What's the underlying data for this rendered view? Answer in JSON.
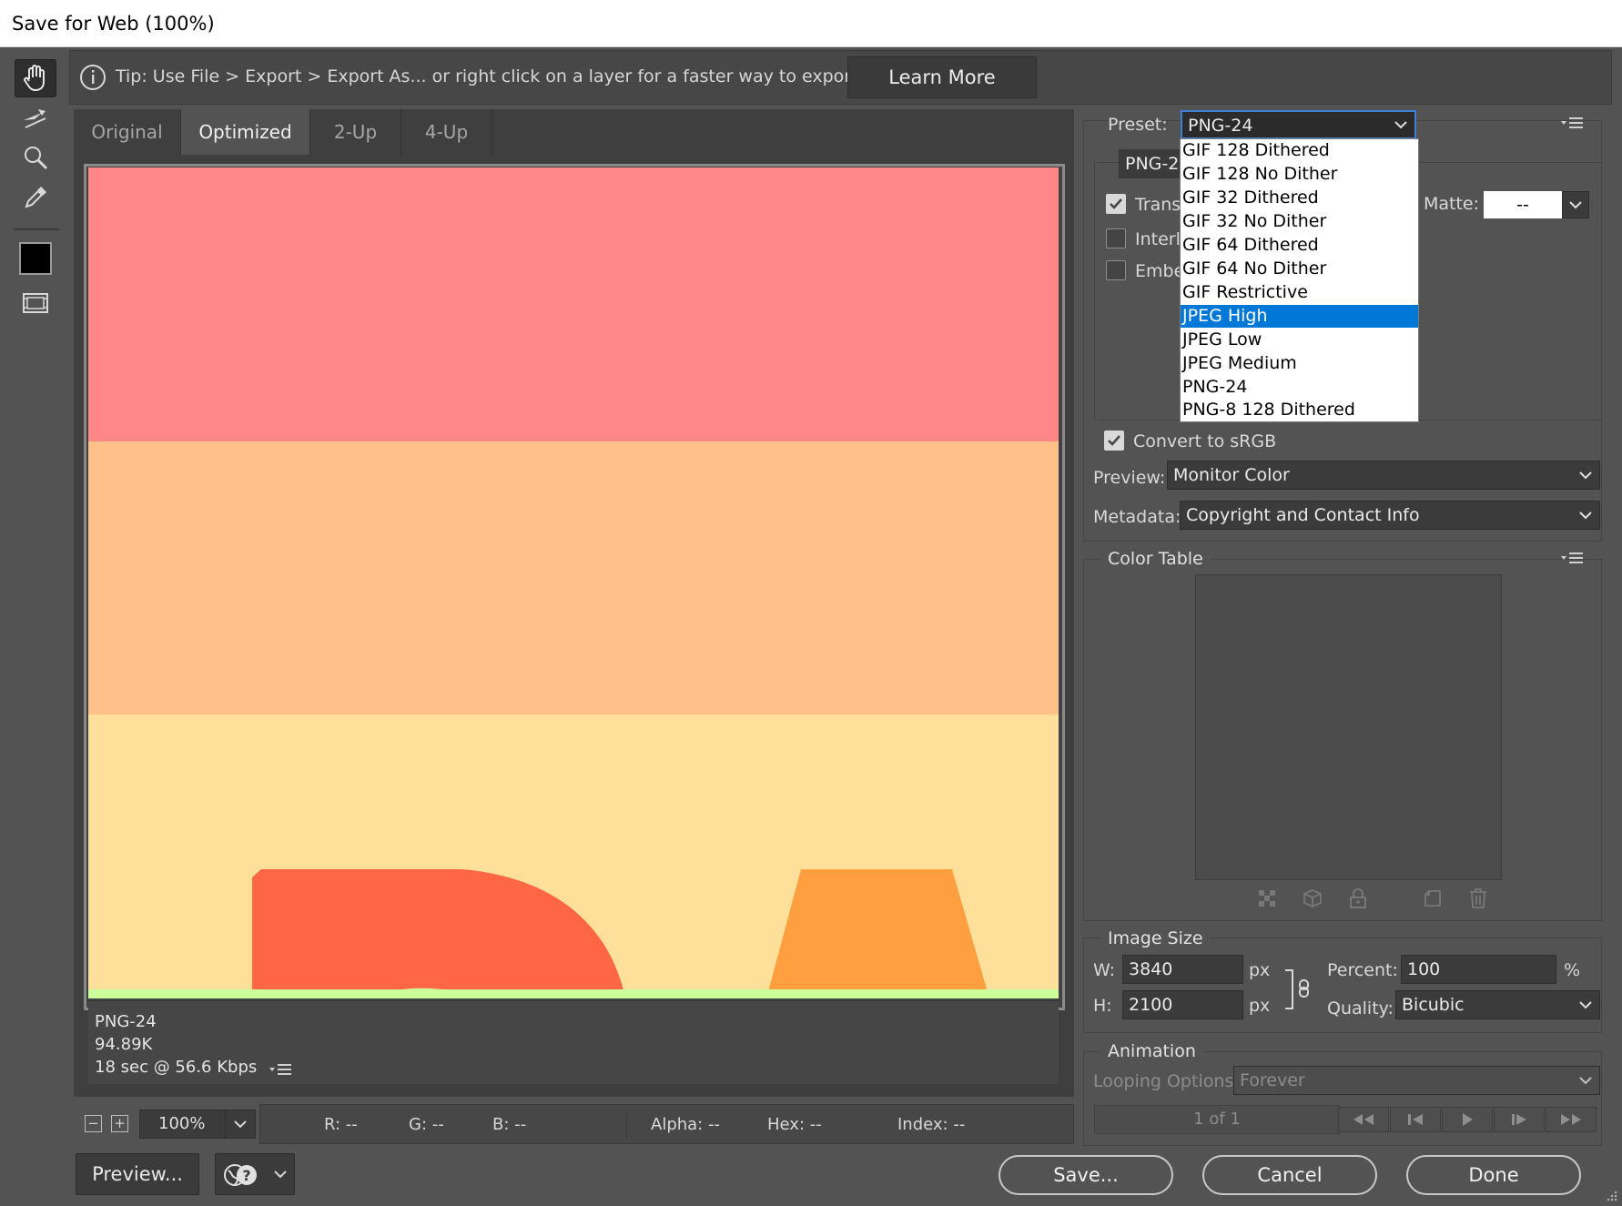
{
  "window": {
    "title": "Save for Web (100%)"
  },
  "tools": [
    {
      "name": "hand-icon",
      "active": true
    },
    {
      "name": "slice-select-icon"
    },
    {
      "name": "zoom-icon"
    },
    {
      "name": "eyedropper-icon"
    },
    {
      "name": "eyedropper-color-swatch",
      "color": "#000000"
    },
    {
      "name": "toggle-slices-icon"
    }
  ],
  "tip": {
    "text": "Tip: Use File > Export > Export As...  or right click on a layer for a faster way to export assets",
    "button": "Learn More"
  },
  "tabs": [
    "Original",
    "Optimized",
    "2-Up",
    "4-Up"
  ],
  "active_tab": "Optimized",
  "preview_info": {
    "format": "PNG-24",
    "size": "94.89K",
    "download": "18 sec @ 56.6 Kbps"
  },
  "status": {
    "zoom": "100%",
    "r": "R: --",
    "g": "G: --",
    "b": "B: --",
    "alpha": "Alpha: --",
    "hex": "Hex: --",
    "index": "Index: --"
  },
  "buttons": {
    "preview": "Preview...",
    "save": "Save...",
    "cancel": "Cancel",
    "done": "Done"
  },
  "settings": {
    "preset_label": "Preset:",
    "preset_value": "PNG-24",
    "format_value": "PNG-24",
    "transparency_label": "Trans",
    "interlaced_label": "Interl",
    "embed_label": "Embe",
    "matte_label": "Matte:",
    "matte_value": "--",
    "convert_srgb": "Convert to sRGB",
    "preview_label": "Preview:",
    "preview_value": "Monitor Color",
    "metadata_label": "Metadata:",
    "metadata_value": "Copyright and Contact Info"
  },
  "preset_options": [
    "GIF 128 Dithered",
    "GIF 128 No Dither",
    "GIF 32 Dithered",
    "GIF 32 No Dither",
    "GIF 64 Dithered",
    "GIF 64 No Dither",
    "GIF Restrictive",
    "JPEG High",
    "JPEG Low",
    "JPEG Medium",
    "PNG-24",
    "PNG-8 128 Dithered"
  ],
  "preset_highlighted": "JPEG High",
  "color_table": {
    "title": "Color Table"
  },
  "image_size": {
    "title": "Image Size",
    "w_label": "W:",
    "w_value": "3840",
    "h_label": "H:",
    "h_value": "2100",
    "unit": "px",
    "percent_label": "Percent:",
    "percent_value": "100",
    "percent_unit": "%",
    "quality_label": "Quality:",
    "quality_value": "Bicubic"
  },
  "animation": {
    "title": "Animation",
    "looping_label": "Looping Options:",
    "looping_value": "Forever",
    "frame_counter": "1 of 1"
  },
  "artwork_colors": {
    "band1": "#ff8787",
    "band2": "#ffc08a",
    "band3": "#ffe09b",
    "shape_red": "#ff6644",
    "shape_orange": "#ff9f40",
    "bottom_line": "#ccff99"
  }
}
